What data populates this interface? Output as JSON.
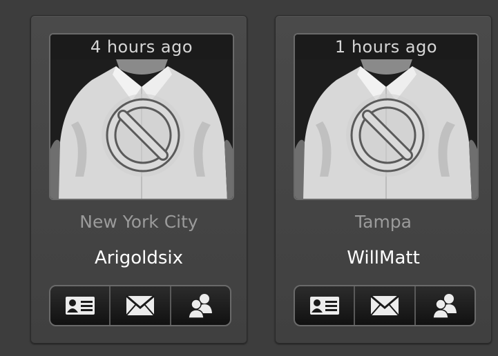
{
  "profiles": [
    {
      "time_ago": "4 hours ago",
      "city": "New York City",
      "username": "Arigoldsix",
      "photo_status": "blocked-icon",
      "actions": [
        "profile-card-icon",
        "mail-icon",
        "users-icon"
      ]
    },
    {
      "time_ago": "1 hours ago",
      "city": "Tampa",
      "username": "WillMatt",
      "photo_status": "blocked-icon",
      "actions": [
        "profile-card-icon",
        "mail-icon",
        "users-icon"
      ]
    }
  ],
  "colors": {
    "background": "#3d3d3d",
    "card": "#454545",
    "city_text": "#9b9b9b",
    "username_text": "#ffffff",
    "timebar": "#1b1b1b"
  }
}
